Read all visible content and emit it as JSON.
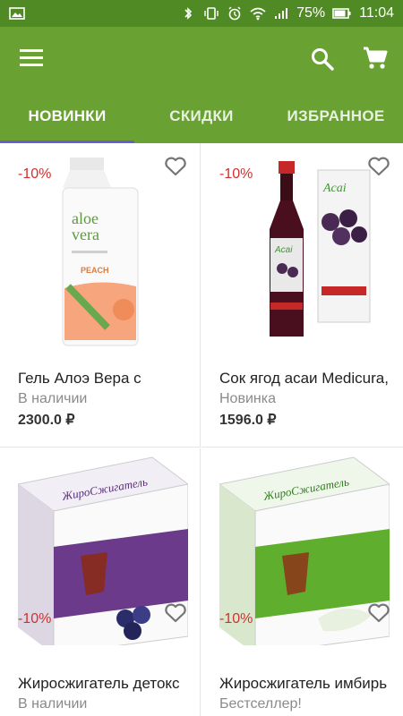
{
  "statusbar": {
    "battery": "75%",
    "time": "11:04"
  },
  "tabs": [
    {
      "label": "НОВИНКИ"
    },
    {
      "label": "СКИДКИ"
    },
    {
      "label": "ИЗБРАННОЕ"
    }
  ],
  "products": [
    {
      "discount": "-10%",
      "title": "Гель Алоэ Вера с",
      "status": "В наличии",
      "price": "2300.0 ₽",
      "image": "aloe-vera-bottle"
    },
    {
      "discount": "-10%",
      "title": "Сок ягод асаи Medicura,",
      "status": "Новинка",
      "price": "1596.0 ₽",
      "image": "acai-juice-bottle-box"
    },
    {
      "discount": "-10%",
      "title": "Жиросжигатель детокс",
      "status": "В наличии",
      "price": "",
      "image": "fatburner-detox-box"
    },
    {
      "discount": "-10%",
      "title": "Жиросжигатель имбирь",
      "status": "Бестселлер!",
      "price": "",
      "image": "fatburner-ginger-box"
    }
  ],
  "colors": {
    "statusbar": "#4f8a25",
    "appbar": "#69a133",
    "tab_indicator": "#6b5bd1",
    "discount": "#d32f2f",
    "status_text": "#8a8a8a"
  }
}
